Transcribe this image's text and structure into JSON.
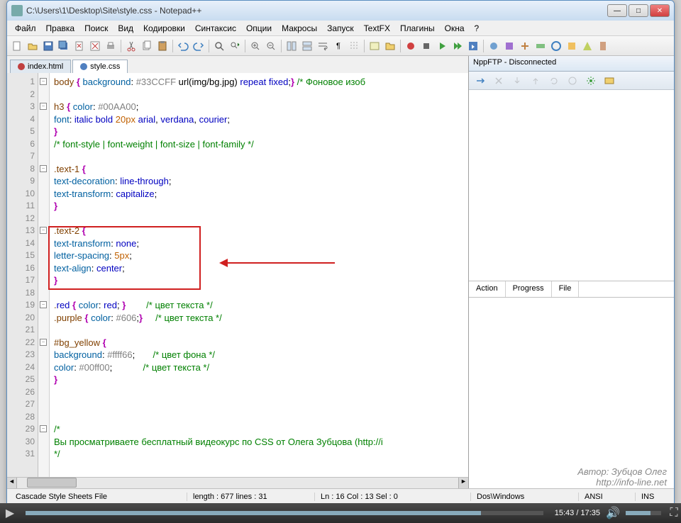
{
  "window": {
    "title": "C:\\Users\\1\\Desktop\\Site\\style.css - Notepad++"
  },
  "menu": [
    "Файл",
    "Правка",
    "Поиск",
    "Вид",
    "Кодировки",
    "Синтаксис",
    "Опции",
    "Макросы",
    "Запуск",
    "TextFX",
    "Плагины",
    "Окна",
    "?"
  ],
  "tabs": [
    {
      "label": "index.html",
      "active": false
    },
    {
      "label": "style.css",
      "active": true
    }
  ],
  "line_numbers": [
    1,
    2,
    3,
    4,
    5,
    6,
    7,
    8,
    9,
    10,
    11,
    12,
    13,
    14,
    15,
    16,
    17,
    18,
    19,
    20,
    21,
    22,
    23,
    24,
    25,
    26,
    27,
    28,
    29,
    30,
    31
  ],
  "code_lines": [
    "body { background: #33CCFF url(img/bg.jpg) repeat fixed;} /* Фоновое изоб",
    "",
    "h3 { color: #00AA00;",
    "font: italic bold 20px arial, verdana, courier;",
    "}",
    "/* font-style | font-weight | font-size | font-family */",
    "",
    ".text-1 {",
    "text-decoration: line-through;",
    "text-transform: capitalize;",
    "}",
    "",
    ".text-2 {",
    "text-transform: none;",
    "letter-spacing: 5px;",
    "text-align: center;",
    "}",
    "",
    ".red { color: red; }        /* цвет текста */",
    ".purple { color: #606;}     /* цвет текста */",
    "",
    "#bg_yellow {",
    "background: #ffff66;       /* цвет фона */",
    "color: #00ff00;            /* цвет текста */",
    "}",
    "",
    "",
    "",
    "/*",
    "Вы просматриваете бесплатный видеокурс по CSS от Олега Зубцова (http://i",
    "*/"
  ],
  "npp_ftp": {
    "title": "NppFTP - Disconnected",
    "tabs": [
      "Action",
      "Progress",
      "File"
    ]
  },
  "status": {
    "lang": "Cascade Style Sheets File",
    "length": "length : 677    lines : 31",
    "pos": "Ln : 16    Col : 13    Sel : 0",
    "eol": "Dos\\Windows",
    "enc": "ANSI",
    "mode": "INS"
  },
  "watermark": {
    "line1": "Автор: Зубцов Олег",
    "line2": "http://info-line.net"
  },
  "taskbar": {
    "time": "15:43 / 17:35"
  },
  "current_line": 16
}
